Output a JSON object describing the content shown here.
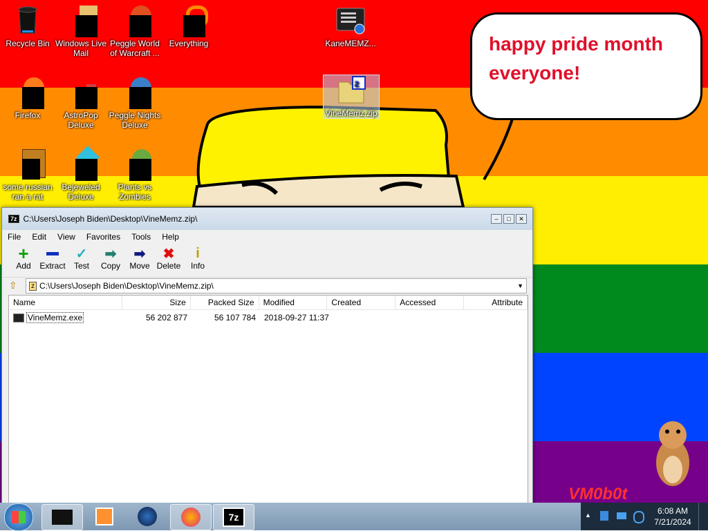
{
  "desktop": {
    "icons": [
      {
        "label": "Recycle Bin"
      },
      {
        "label": "Windows Live Mail"
      },
      {
        "label": "Peggle World of Warcraft ..."
      },
      {
        "label": "Everything"
      },
      {
        "label": "KaneMEMZ..."
      },
      {
        "label": "Firefox"
      },
      {
        "label": "AstroPop Deluxe"
      },
      {
        "label": "Peggle Nights Deluxe"
      },
      {
        "label": "VineMemz.zip"
      },
      {
        "label": "some russian ran a rat"
      },
      {
        "label": "Bejeweled Deluxe"
      },
      {
        "label": "Plants vs Zombies"
      }
    ],
    "bubble_line1": "happy pride month",
    "bubble_line2": "everyone!",
    "watermark": "VM0b0t"
  },
  "window": {
    "title": "C:\\Users\\Joseph Biden\\Desktop\\VineMemz.zip\\",
    "menu": [
      "File",
      "Edit",
      "View",
      "Favorites",
      "Tools",
      "Help"
    ],
    "toolbar": [
      "Add",
      "Extract",
      "Test",
      "Copy",
      "Move",
      "Delete",
      "Info"
    ],
    "address": "C:\\Users\\Joseph Biden\\Desktop\\VineMemz.zip\\",
    "columns": [
      "Name",
      "Size",
      "Packed Size",
      "Modified",
      "Created",
      "Accessed",
      "Attribute"
    ],
    "files": [
      {
        "name": "VineMemz.exe",
        "size": "56 202 877",
        "packed": "56 107 784",
        "modified": "2018-09-27 11:37",
        "created": "",
        "accessed": "",
        "attr": ""
      }
    ]
  },
  "taskbar": {
    "time": "6:08 AM",
    "date": "7/21/2024"
  },
  "colors": {
    "red": "#ff0000",
    "orange": "#ff8c00",
    "yellow": "#ffee00",
    "green": "#008a1e",
    "blue": "#0044ff",
    "purple": "#760089"
  }
}
